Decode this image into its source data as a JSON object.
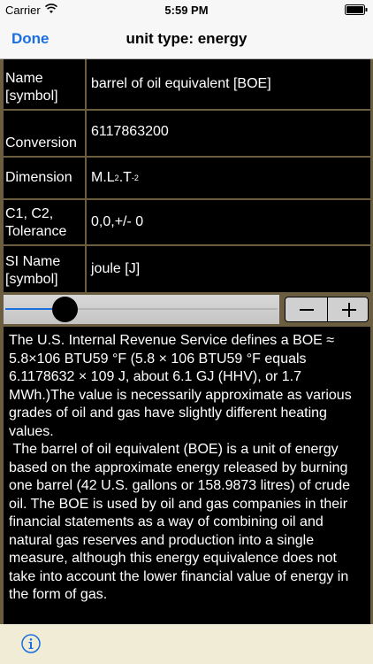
{
  "status_bar": {
    "carrier": "Carrier",
    "time": "5:59 PM"
  },
  "nav": {
    "done_label": "Done",
    "title": "unit type: energy"
  },
  "rows": [
    {
      "label": "Name [symbol]",
      "value": "barrel of oil equivalent [BOE]"
    },
    {
      "label": "Conversion",
      "value": "6117863200"
    },
    {
      "label": "Dimension",
      "value_main_1": "M.L",
      "value_sup_1": "2",
      "value_main_2": ".T",
      "value_sup_2": "-2"
    },
    {
      "label": "C1, C2, Tolerance",
      "value": "0,0,+/- 0"
    },
    {
      "label": "SI Name [symbol]",
      "value": "joule [J]"
    }
  ],
  "slider": {
    "value_fraction": 0.22
  },
  "description": "The U.S. Internal Revenue Service defines a BOE ≈ 5.8×106 BTU59 °F (5.8 × 106 BTU59 °F equals 6.1178632 × 109 J, about 6.1 GJ (HHV), or 1.7 MWh.)The value is necessarily approximate as various grades of oil and gas have slightly different heating values.\n The barrel of oil equivalent (BOE) is a unit of energy based on the approximate energy released by burning one barrel (42 U.S. gallons or 158.9873 litres) of crude oil. The BOE is used by oil and gas companies in their financial statements as a way of combining oil and natural gas reserves and production into a single measure, although this energy equivalence does not take into account the lower financial value of energy in the form of gas.",
  "colors": {
    "accent": "#1a6fe0",
    "background": "#6b5d3f",
    "cell": "#000000"
  },
  "icons": {
    "wifi": "wifi-icon",
    "battery": "battery-icon",
    "info": "info-icon"
  }
}
